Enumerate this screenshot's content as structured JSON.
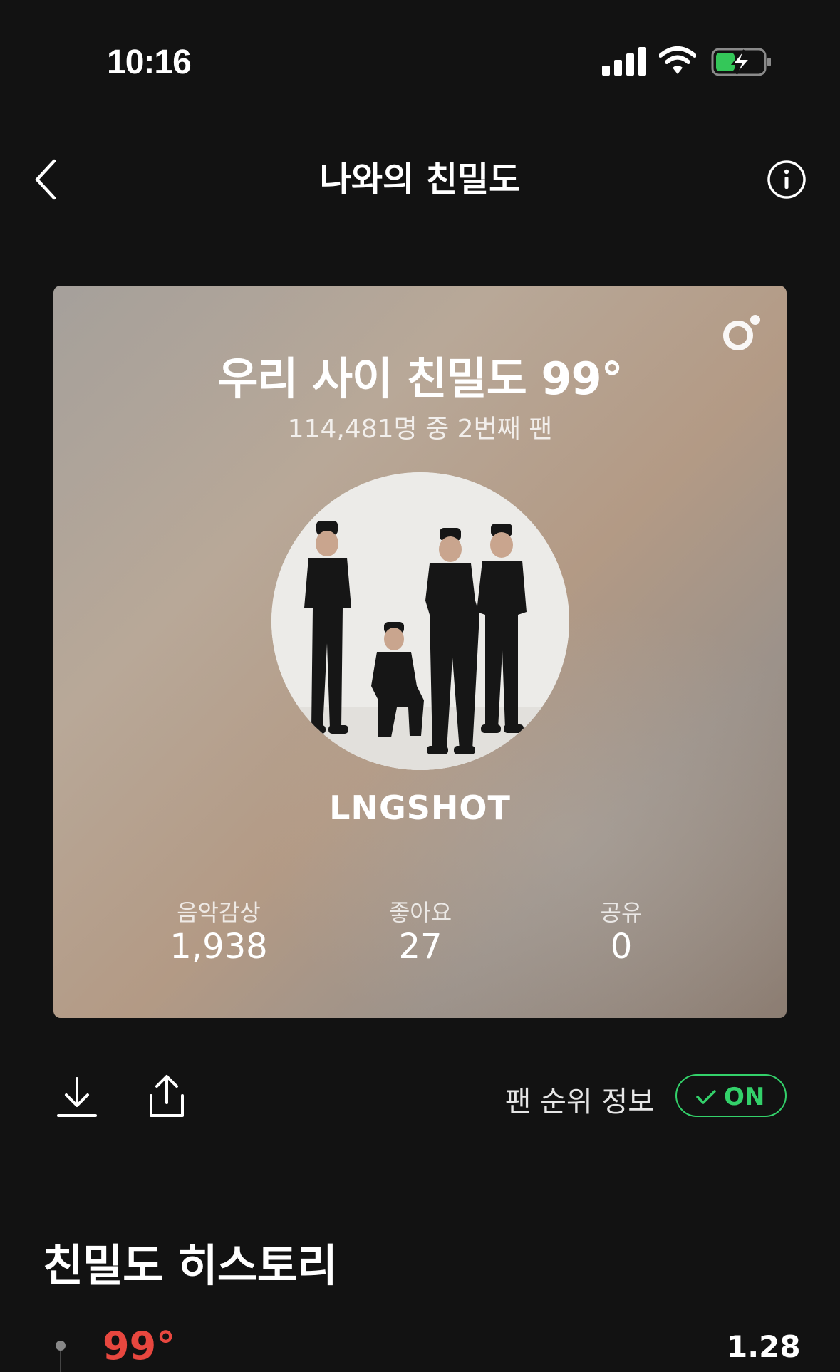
{
  "status_bar": {
    "time": "10:16"
  },
  "nav": {
    "title": "나와의 친밀도"
  },
  "card": {
    "title": "우리 사이 친밀도 99°",
    "subtitle": "114,481명 중 2번째 팬",
    "artist": "LNGSHOT",
    "stats": [
      {
        "label": "음악감상",
        "value": "1,938"
      },
      {
        "label": "좋아요",
        "value": "27"
      },
      {
        "label": "공유",
        "value": "0"
      }
    ]
  },
  "actions": {
    "rank_label": "팬 순위 정보",
    "toggle_text": "ON"
  },
  "history": {
    "title": "친밀도 히스토리",
    "items": [
      {
        "degree": "99°",
        "date": "1.28"
      }
    ]
  },
  "colors": {
    "background": "#121212",
    "accent_green": "#33d16a",
    "history_red": "#e8473f"
  }
}
